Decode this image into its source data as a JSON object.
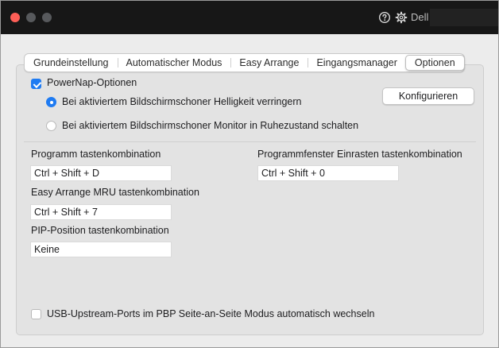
{
  "window": {
    "brand_label": "Dell"
  },
  "tabs": [
    {
      "label": "Grundeinstellung"
    },
    {
      "label": "Automatischer Modus"
    },
    {
      "label": "Easy Arrange"
    },
    {
      "label": "Eingangsmanager"
    },
    {
      "label": "Optionen",
      "active": true
    }
  ],
  "powernap": {
    "checkbox_label": "PowerNap-Optionen",
    "checked": true,
    "option_dim": "Bei aktiviertem Bildschirmschoner Helligkeit verringern",
    "option_sleep": "Bei aktiviertem Bildschirmschoner Monitor in Ruhezustand schalten",
    "selected": "option_dim",
    "configure_button": "Konfigurieren"
  },
  "shortcuts": {
    "program": {
      "label": "Programm tastenkombination",
      "value": "Ctrl + Shift + D"
    },
    "easy_arrange_mru": {
      "label": "Easy Arrange MRU tastenkombination",
      "value": "Ctrl + Shift + 7"
    },
    "pip_position": {
      "label": "PIP-Position tastenkombination",
      "value": "Keine"
    },
    "window_snap": {
      "label": "Programmfenster Einrasten tastenkombination",
      "value": "Ctrl + Shift + 0"
    }
  },
  "usb": {
    "checkbox_label": "USB-Upstream-Ports im PBP Seite-an-Seite Modus automatisch wechseln",
    "checked": false
  },
  "colors": {
    "accent": "#1f7bf2",
    "titlebar": "#171717"
  }
}
